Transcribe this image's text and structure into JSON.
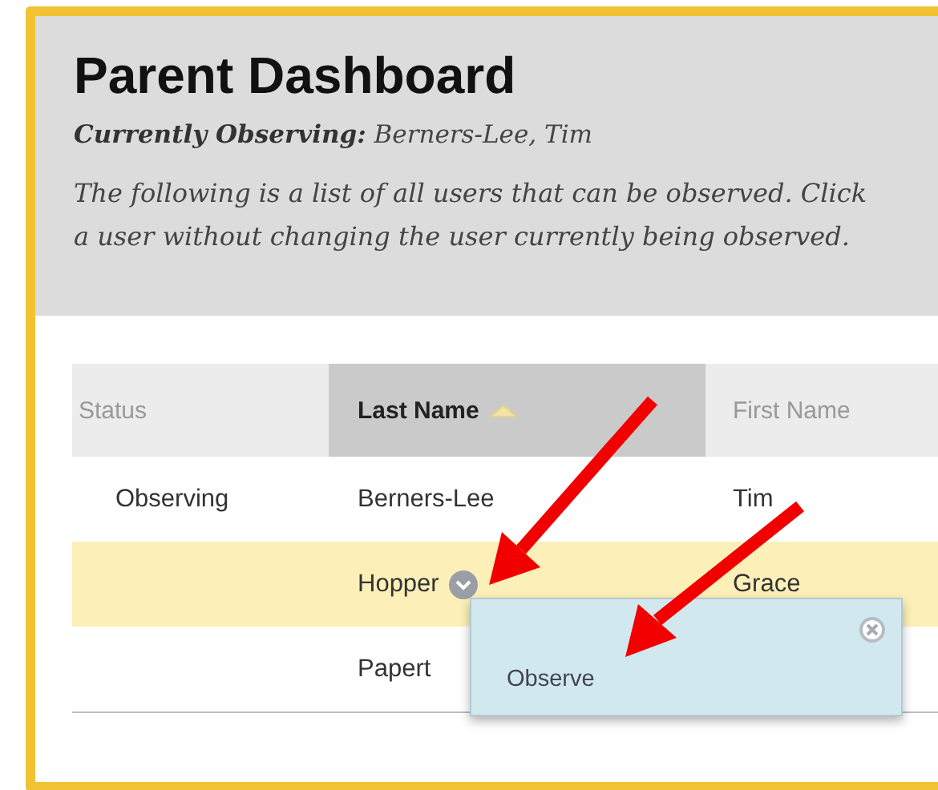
{
  "title": "Parent Dashboard",
  "observing": {
    "label": "Currently Observing:",
    "value": "Berners-Lee, Tim"
  },
  "description_lines": [
    "The following is a list of all users that can be observed. Click",
    "a user without changing the user currently being observed."
  ],
  "table": {
    "columns": [
      {
        "label": "Status",
        "sorted": false
      },
      {
        "label": "Last Name",
        "sorted": true
      },
      {
        "label": "First Name",
        "sorted": false
      }
    ],
    "rows": [
      {
        "status": "Observing",
        "last_name": "Berners-Lee",
        "first_name": "Tim",
        "highlighted": false,
        "menu": false
      },
      {
        "last_name": "Hopper",
        "first_name": "Grace",
        "highlighted": true,
        "menu": true
      },
      {
        "last_name": "Papert",
        "highlighted": false,
        "menu": false
      }
    ]
  },
  "context_menu": {
    "items": [
      "Observe"
    ]
  }
}
